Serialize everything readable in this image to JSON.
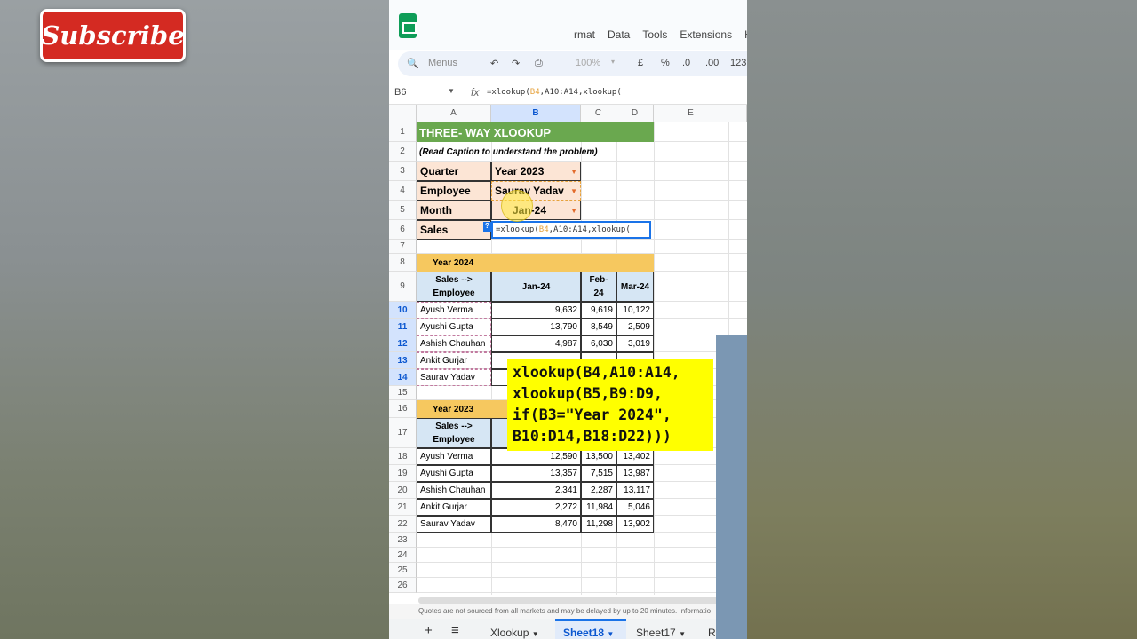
{
  "menu": {
    "items": [
      "rmat",
      "Data",
      "Tools",
      "Extensions",
      "H"
    ]
  },
  "subscribe": {
    "label": "Subscribe"
  },
  "toolbar": {
    "menus": "Menus",
    "zoom": "100%",
    "currency": "£",
    "percent": "%",
    "dec_dec": ".0",
    "dec_inc": ".00",
    "format": "123"
  },
  "formula_bar": {
    "cell_ref": "B6",
    "fx": "fx",
    "formula_pre": "=xlookup(",
    "formula_ref": "B4",
    "formula_post": ",A10:A14,xlookup("
  },
  "columns": [
    "A",
    "B",
    "C",
    "D",
    "E"
  ],
  "rows": [
    "1",
    "2",
    "3",
    "4",
    "5",
    "6",
    "7",
    "8",
    "9",
    "10",
    "11",
    "12",
    "13",
    "14",
    "15",
    "16",
    "17",
    "18",
    "19",
    "20",
    "21",
    "22",
    "23",
    "24",
    "25",
    "26"
  ],
  "sheet": {
    "title": "THREE- WAY XLOOKUP",
    "caption": "(Read Caption to understand the problem)",
    "inputs": [
      {
        "label": "Quarter",
        "value": "Year 2023"
      },
      {
        "label": "Employee",
        "value": "Saurav Yadav"
      },
      {
        "label": "Month",
        "value": "Jan-24"
      }
    ],
    "sales_label": "Sales",
    "active_cell_pre": "=xlookup(",
    "active_cell_ref": "B4",
    "active_cell_post": ",A10:A14,xlookup(",
    "help_badge": "?",
    "year_2024": "Year 2024",
    "year_2023": "Year 2023",
    "header_corner": "Sales -->\nEmployee",
    "months": [
      "Jan-24",
      "Feb-24",
      "Mar-24"
    ],
    "table_2024": [
      {
        "name": "Ayush Verma",
        "values": [
          "9,632",
          "9,619",
          "10,122"
        ]
      },
      {
        "name": "Ayushi Gupta",
        "values": [
          "13,790",
          "8,549",
          "2,509"
        ]
      },
      {
        "name": "Ashish Chauhan",
        "values": [
          "4,987",
          "6,030",
          "3,019"
        ]
      },
      {
        "name": "Ankit Gurjar",
        "values": [
          "",
          "",
          ""
        ]
      },
      {
        "name": "Saurav Yadav",
        "values": [
          "",
          "",
          ""
        ]
      }
    ],
    "table_2023": [
      {
        "name": "Ayush Verma",
        "values": [
          "12,590",
          "13,500",
          "13,402"
        ]
      },
      {
        "name": "Ayushi Gupta",
        "values": [
          "13,357",
          "7,515",
          "13,987"
        ]
      },
      {
        "name": "Ashish Chauhan",
        "values": [
          "2,341",
          "2,287",
          "13,117"
        ]
      },
      {
        "name": "Ankit Gurjar",
        "values": [
          "2,272",
          "11,984",
          "5,046"
        ]
      },
      {
        "name": "Saurav Yadav",
        "values": [
          "8,470",
          "11,298",
          "13,902"
        ]
      }
    ]
  },
  "overlay_formula": [
    "xlookup(B4,A10:A14,",
    "xlookup(B5,B9:D9,",
    "if(B3=\"Year 2024\",",
    "B10:D14,B18:D22)))"
  ],
  "footer_note": "Quotes are not sourced from all markets and may be delayed by up to 20 minutes. Informatio",
  "sheet_tabs": {
    "add": "+",
    "all": "≡",
    "tabs": [
      "Xlookup",
      "Sheet18",
      "Sheet17",
      "Raw Da"
    ],
    "active": "Sheet18"
  }
}
